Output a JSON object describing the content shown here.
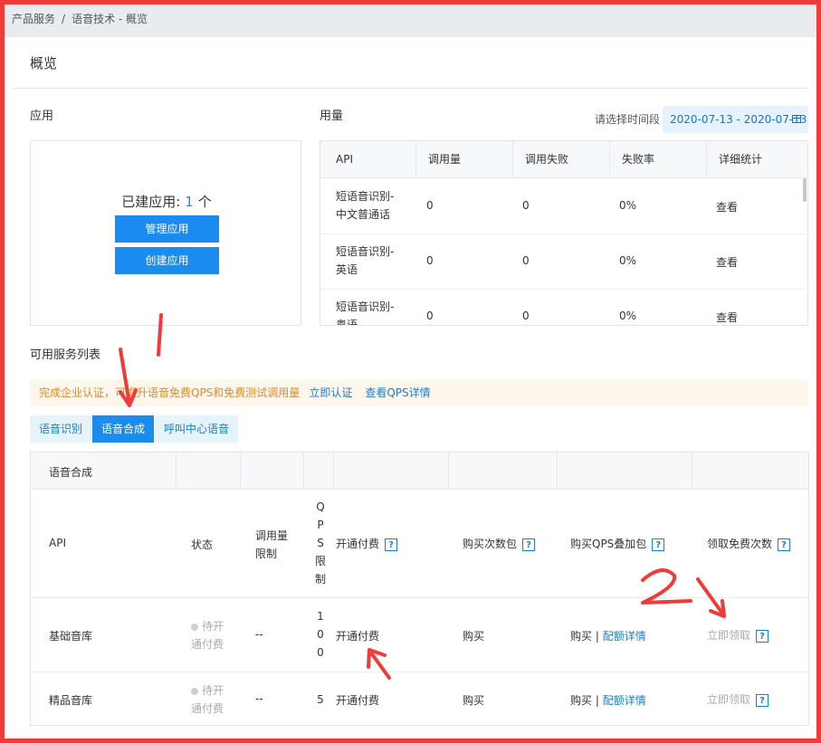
{
  "breadcrumb": {
    "parent": "产品服务",
    "separator": "/",
    "current": "语音技术 - 概览"
  },
  "page_title": "概览",
  "apps": {
    "title": "应用",
    "count_label": "已建应用:",
    "count": "1",
    "count_unit": "个",
    "manage_label": "管理应用",
    "create_label": "创建应用"
  },
  "usage": {
    "title": "用量",
    "date_label": "请选择时间段",
    "date_range": "2020-07-13 - 2020-07-13",
    "headers": [
      "API",
      "调用量",
      "调用失败",
      "失败率",
      "详细统计"
    ],
    "rows": [
      {
        "name1": "短语音识别-",
        "name2": "中文普通话",
        "calls": "0",
        "fails": "0",
        "rate": "0%",
        "detail": "查看"
      },
      {
        "name1": "短语音识别-",
        "name2": "英语",
        "calls": "0",
        "fails": "0",
        "rate": "0%",
        "detail": "查看"
      },
      {
        "name1": "短语音识别-",
        "name2": "粤语",
        "calls": "0",
        "fails": "0",
        "rate": "0%",
        "detail": "查看"
      }
    ]
  },
  "services": {
    "title": "可用服务列表",
    "notice_text": "完成企业认证，可提升语音免费QPS和免费测试调用量",
    "notice_link1": "立即认证",
    "notice_link2": "查看QPS详情",
    "tabs": [
      "语音识别",
      "语音合成",
      "呼叫中心语音"
    ],
    "group_label": "语音合成",
    "headers": {
      "api": "API",
      "status": "状态",
      "limit1": "调用量",
      "limit2": "限制",
      "qps": [
        "Q",
        "P",
        "S",
        "限",
        "制"
      ],
      "pay": "开通付费",
      "buy_count": "购买次数包",
      "buy_qps": "购买QPS叠加包",
      "free": "领取免费次数",
      "help": "?"
    },
    "rows": [
      {
        "api": "基础音库",
        "status1": "待开",
        "status2": "通付费",
        "limit": "--",
        "qps": [
          "1",
          "0",
          "0"
        ],
        "pay": "开通付费",
        "buy": "购买",
        "qps_buy": "购买",
        "qps_sep": "|",
        "quota": "配额详情",
        "free": "立即领取"
      },
      {
        "api": "精品音库",
        "status1": "待开",
        "status2": "通付费",
        "limit": "--",
        "qps": [
          "5"
        ],
        "pay": "开通付费",
        "buy": "购买",
        "qps_buy": "购买",
        "qps_sep": "|",
        "quota": "配额详情",
        "free": "立即领取"
      }
    ]
  },
  "annotations": {
    "mark1": "1",
    "mark2": "2",
    "color": "#f23a3a"
  }
}
